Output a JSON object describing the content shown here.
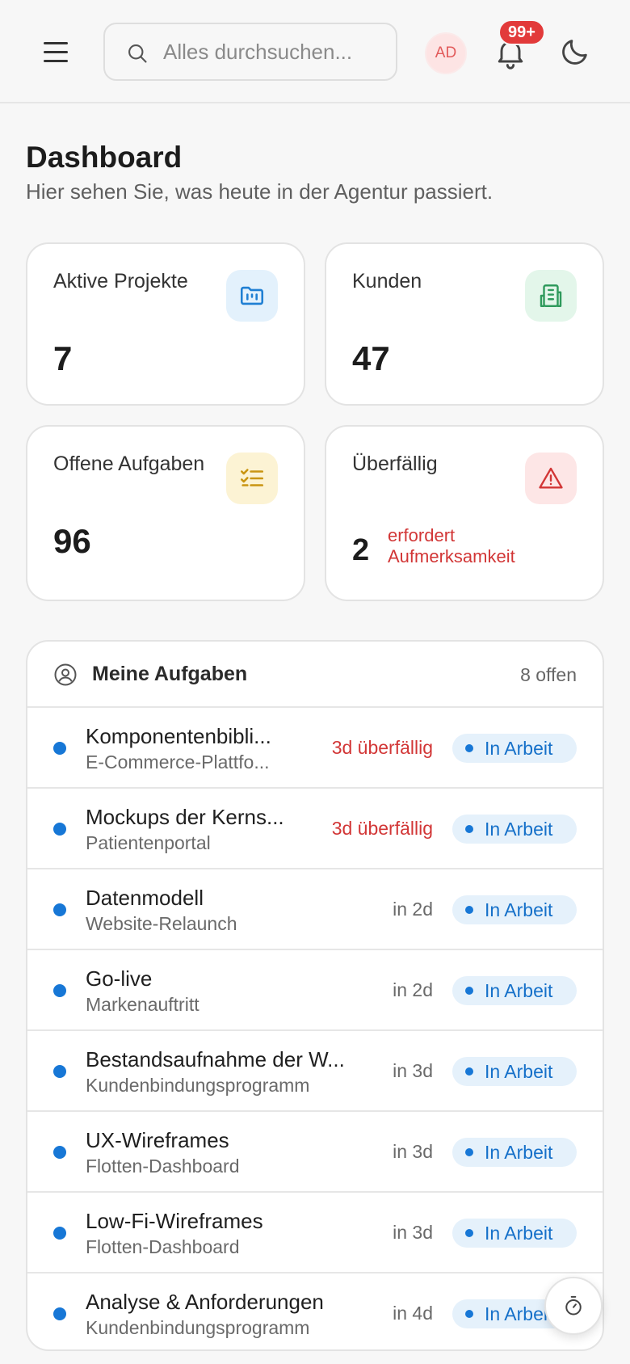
{
  "header": {
    "search_placeholder": "Alles durchsuchen...",
    "avatar_initials": "AD",
    "notification_count": "99+"
  },
  "page": {
    "title": "Dashboard",
    "subtitle": "Hier sehen Sie, was heute in der Agentur passiert."
  },
  "stats": [
    {
      "label": "Aktive Projekte",
      "value": "7",
      "icon": "folder-kanban-icon",
      "accent": "#1f7fd3",
      "bg": "#e3f1fc"
    },
    {
      "label": "Kunden",
      "value": "47",
      "icon": "building-icon",
      "accent": "#2f9a5c",
      "bg": "#e3f6ea"
    },
    {
      "label": "Offene Aufgaben",
      "value": "96",
      "icon": "list-checks-icon",
      "accent": "#c99512",
      "bg": "#fcf3d4"
    },
    {
      "label": "Überfällig",
      "value": "2",
      "note": "erfordert Aufmerksamkeit",
      "icon": "alert-triangle-icon",
      "accent": "#d23636",
      "bg": "#fde6e6"
    }
  ],
  "tasks": {
    "title": "Meine Aufgaben",
    "count": "8 offen",
    "items": [
      {
        "title": "Komponentenbibli...",
        "project": "E-Commerce-Plattfo...",
        "due": "3d überfällig",
        "overdue": true,
        "status": "In Arbeit"
      },
      {
        "title": "Mockups der Kerns...",
        "project": "Patientenportal",
        "due": "3d überfällig",
        "overdue": true,
        "status": "In Arbeit"
      },
      {
        "title": "Datenmodell",
        "project": "Website-Relaunch",
        "due": "in 2d",
        "overdue": false,
        "status": "In Arbeit"
      },
      {
        "title": "Go-live",
        "project": "Markenauftritt",
        "due": "in 2d",
        "overdue": false,
        "status": "In Arbeit"
      },
      {
        "title": "Bestandsaufnahme der W...",
        "project": "Kundenbindungsprogramm",
        "due": "in 3d",
        "overdue": false,
        "status": "In Arbeit"
      },
      {
        "title": "UX-Wireframes",
        "project": "Flotten-Dashboard",
        "due": "in 3d",
        "overdue": false,
        "status": "In Arbeit"
      },
      {
        "title": "Low-Fi-Wireframes",
        "project": "Flotten-Dashboard",
        "due": "in 3d",
        "overdue": false,
        "status": "In Arbeit"
      },
      {
        "title": "Analyse & Anforderungen",
        "project": "Kundenbindungsprogramm",
        "due": "in 4d",
        "overdue": false,
        "status": "In Arbeit"
      }
    ]
  },
  "colors": {
    "status_blue": "#1570c9",
    "overdue_red": "#d23636",
    "badge_red": "#e23a3a"
  }
}
